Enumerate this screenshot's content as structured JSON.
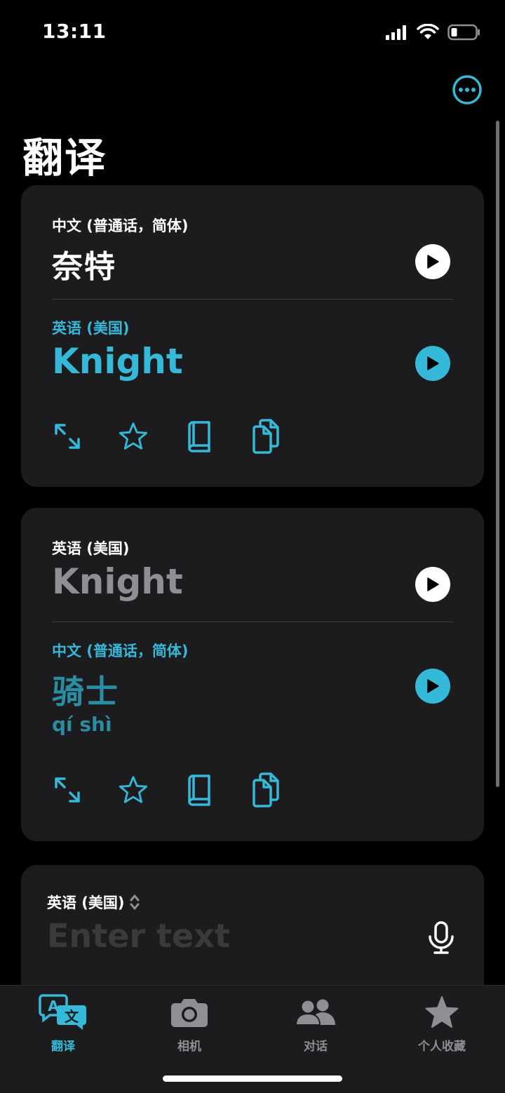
{
  "status": {
    "time": "13:11"
  },
  "page": {
    "title": "翻译"
  },
  "cards": [
    {
      "source": {
        "lang": "中文 (普通话，简体)",
        "text": "奈特"
      },
      "target": {
        "lang": "英语 (美国)",
        "text": "Knight"
      }
    },
    {
      "source": {
        "lang": "英语 (美国)",
        "text": "Knight"
      },
      "target": {
        "lang": "中文 (普通话，简体)",
        "text": "骑士",
        "pinyin": "qí shì"
      }
    }
  ],
  "input": {
    "lang": "英语 (美国)",
    "placeholder": "Enter text"
  },
  "tabs": [
    {
      "label": "翻译",
      "icon": "translate-icon",
      "active": true
    },
    {
      "label": "相机",
      "icon": "camera-icon",
      "active": false
    },
    {
      "label": "对话",
      "icon": "people-icon",
      "active": false
    },
    {
      "label": "个人收藏",
      "icon": "star-icon",
      "active": false
    }
  ],
  "colors": {
    "accent": "#34b9d9",
    "card": "#1c1c1e",
    "background": "#000000"
  }
}
